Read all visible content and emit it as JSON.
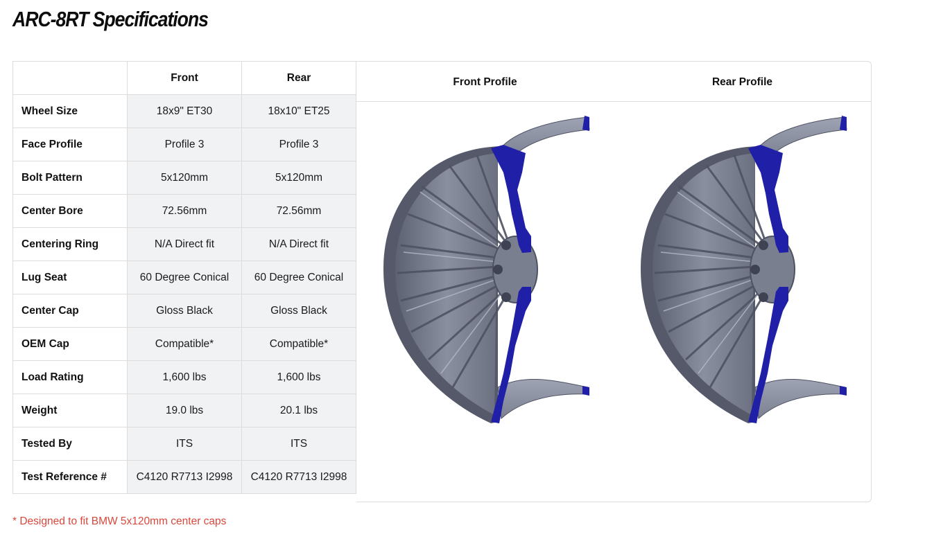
{
  "title": "ARC-8RT Specifications",
  "table": {
    "columns": [
      "Front",
      "Rear"
    ],
    "rows": [
      {
        "label": "Wheel Size",
        "front": "18x9\" ET30",
        "rear": "18x10\" ET25"
      },
      {
        "label": "Face Profile",
        "front": "Profile 3",
        "rear": "Profile 3"
      },
      {
        "label": "Bolt Pattern",
        "front": "5x120mm",
        "rear": "5x120mm"
      },
      {
        "label": "Center Bore",
        "front": "72.56mm",
        "rear": "72.56mm"
      },
      {
        "label": "Centering Ring",
        "front": "N/A Direct fit",
        "rear": "N/A Direct fit"
      },
      {
        "label": "Lug Seat",
        "front": "60 Degree Conical",
        "rear": "60 Degree Conical"
      },
      {
        "label": "Center Cap",
        "front": "Gloss Black",
        "rear": "Gloss Black"
      },
      {
        "label": "OEM Cap",
        "front": "Compatible*",
        "rear": "Compatible*"
      },
      {
        "label": "Load Rating",
        "front": "1,600 lbs",
        "rear": "1,600 lbs"
      },
      {
        "label": "Weight",
        "front": "19.0 lbs",
        "rear": "20.1 lbs"
      },
      {
        "label": "Tested By",
        "front": "ITS",
        "rear": "ITS"
      },
      {
        "label": "Test Reference #",
        "front": "C4120 R7713 I2998",
        "rear": "C4120 R7713 I2998"
      }
    ]
  },
  "profiles": {
    "front_label": "Front Profile",
    "rear_label": "Rear Profile"
  },
  "footnote": "* Designed to fit BMW 5x120mm center caps",
  "colors": {
    "footnote": "#d9473b",
    "value_cell_bg": "#f1f2f4",
    "wheel_body": "#6e7383",
    "wheel_section": "#1f1fa8"
  }
}
